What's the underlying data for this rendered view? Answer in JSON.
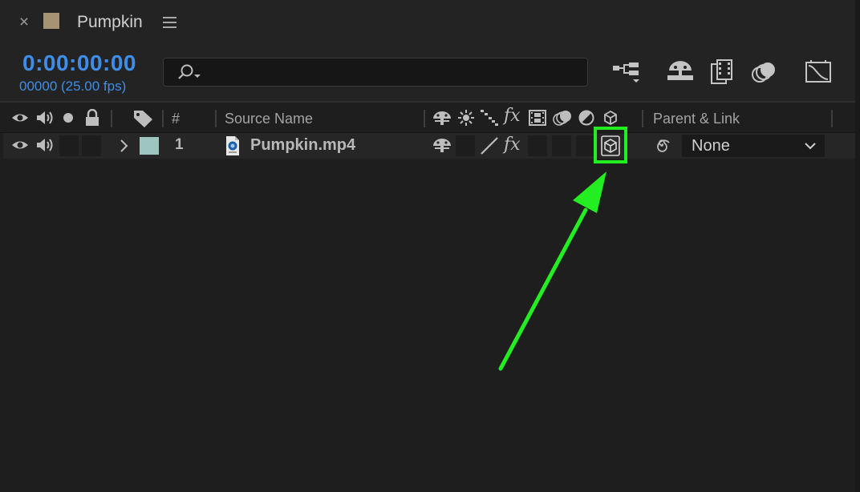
{
  "tab": {
    "close": "×",
    "title": "Pumpkin",
    "swatch_color": "#a69374",
    "menu_icon": "hamburger-icon"
  },
  "header": {
    "timecode": "0:00:00:00",
    "fps": "00000 (25.00 fps)",
    "search": {
      "value": "",
      "placeholder": ""
    },
    "tools": [
      "composition-flowchart-icon",
      "shy-layers-icon",
      "frame-blending-icon",
      "motion-blur-icon",
      "graph-editor-icon"
    ]
  },
  "columns": {
    "number_label": "#",
    "source_name_label": "Source Name",
    "parent_label": "Parent & Link",
    "switch_icons": [
      "shy-icon",
      "collapse-icon",
      "quality-icon",
      "effects-icon",
      "frame-blend-icon",
      "motion-blur-icon",
      "adjustment-icon",
      "3d-layer-icon"
    ]
  },
  "layers": [
    {
      "number": "1",
      "name": "Pumpkin.mp4",
      "label_color": "#9fc5c1",
      "parent": "None",
      "highlighted_switch": "3d-layer-icon"
    }
  ],
  "annotation": {
    "color": "#22ee22"
  }
}
